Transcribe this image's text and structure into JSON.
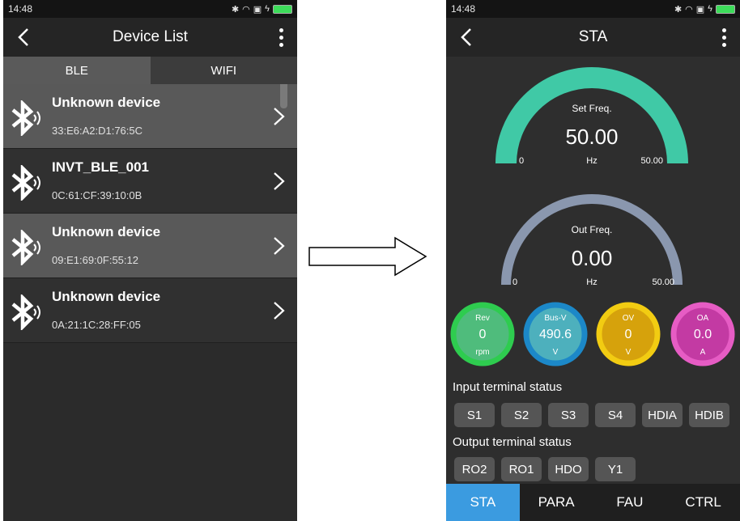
{
  "colors": {
    "teal": "#40c9a6",
    "slate": "#8a97ae",
    "green": "#2ecc4f",
    "blue": "#1c88c8",
    "yellow": "#f2cc12",
    "magenta": "#e65cc4",
    "nav_active": "#3b9be0"
  },
  "left": {
    "status": {
      "time": "14:48"
    },
    "appbar": {
      "title": "Device List"
    },
    "tabs": [
      "BLE",
      "WIFI"
    ],
    "devices": [
      {
        "name": "Unknown device",
        "address": "33:E6:A2:D1:76:5C"
      },
      {
        "name": "INVT_BLE_001",
        "address": "0C:61:CF:39:10:0B"
      },
      {
        "name": "Unknown device",
        "address": "09:E1:69:0F:55:12"
      },
      {
        "name": "Unknown device",
        "address": "0A:21:1C:28:FF:05"
      }
    ]
  },
  "right": {
    "status": {
      "time": "14:48"
    },
    "appbar": {
      "title": "STA"
    },
    "gauges": [
      {
        "label": "Set Freq.",
        "value": "50.00",
        "unit": "Hz",
        "min": "0",
        "max": "50.00",
        "fraction": 1.0
      },
      {
        "label": "Out Freq.",
        "value": "0.00",
        "unit": "Hz",
        "min": "0",
        "max": "50.00",
        "fraction": 0.0
      }
    ],
    "circles": [
      {
        "label": "Rev",
        "value": "0",
        "unit": "rpm"
      },
      {
        "label": "Bus-V",
        "value": "490.6",
        "unit": "V"
      },
      {
        "label": "OV",
        "value": "0",
        "unit": "V"
      },
      {
        "label": "OA",
        "value": "0.0",
        "unit": "A"
      }
    ],
    "input_title": "Input terminal status",
    "input_terminals": [
      "S1",
      "S2",
      "S3",
      "S4",
      "HDIA",
      "HDIB"
    ],
    "output_title": "Output terminal status",
    "output_terminals": [
      "RO2",
      "RO1",
      "HDO",
      "Y1"
    ],
    "nav": [
      "STA",
      "PARA",
      "FAU",
      "CTRL"
    ]
  }
}
